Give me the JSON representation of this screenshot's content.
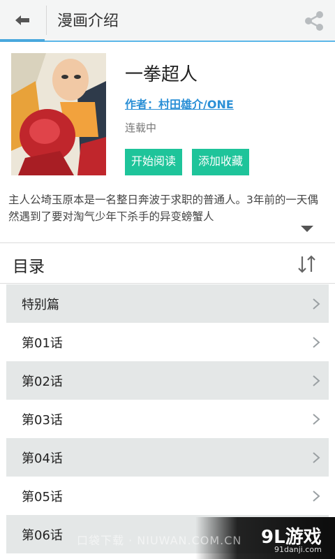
{
  "header": {
    "title": "漫画介绍"
  },
  "comic": {
    "name": "一拳超人",
    "author": "作者：村田雄介/ONE",
    "status": "连载中",
    "read_button": "开始阅读",
    "favorite_button": "添加收藏",
    "description": "主人公埼玉原本是一名整日奔波于求职的普通人。3年前的一天偶然遇到了要对淘气少年下杀手的异变螃蟹人"
  },
  "toc": {
    "title": "目录",
    "chapters": [
      "特别篇",
      "第01话",
      "第02话",
      "第03话",
      "第04话",
      "第05话",
      "第06话"
    ]
  },
  "watermark": {
    "left_text": "口袋下载 · NIUWAN.COM.CN",
    "logo": "9L游戏",
    "url": "91danji.com"
  },
  "colors": {
    "accent_blue": "#5bb7e9",
    "button_green": "#1ec49a",
    "link_blue": "#2a8fd6",
    "row_gray": "#e4e7e7"
  },
  "icons": [
    "back-arrow-icon",
    "share-icon",
    "sort-icon",
    "chevron-right-icon",
    "expand-arrow-icon"
  ]
}
